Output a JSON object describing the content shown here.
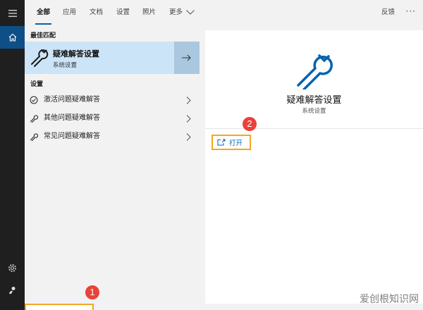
{
  "rail": {
    "icons": [
      "hamburger-menu-icon",
      "home-icon",
      "gear-icon",
      "user-icon"
    ]
  },
  "tabs": [
    {
      "label": "全部",
      "active": true
    },
    {
      "label": "应用",
      "active": false
    },
    {
      "label": "文档",
      "active": false
    },
    {
      "label": "设置",
      "active": false
    },
    {
      "label": "照片",
      "active": false
    },
    {
      "label": "更多",
      "active": false
    }
  ],
  "topbar": {
    "feedback_label": "反馈",
    "more_label": "···"
  },
  "results": {
    "best_match_header": "最佳匹配",
    "best_match": {
      "title": "疑难解答设置",
      "subtitle": "系统设置"
    },
    "settings_header": "设置",
    "items": [
      {
        "label": "激活问题疑难解答",
        "icon": "check-circle-icon"
      },
      {
        "label": "其他问题疑难解答",
        "icon": "wrench-icon"
      },
      {
        "label": "常见问题疑难解答",
        "icon": "wrench-icon"
      }
    ]
  },
  "detail": {
    "title": "疑难解答设置",
    "subtitle": "系统设置",
    "open_label": "打开"
  },
  "annotations": {
    "badge1": "1",
    "badge2": "2"
  },
  "watermark": "爱创根知识网",
  "colors": {
    "accent": "#0063b1",
    "highlight": "#cce4f7",
    "annotation": "#f5a623",
    "badge": "#e8423a"
  }
}
